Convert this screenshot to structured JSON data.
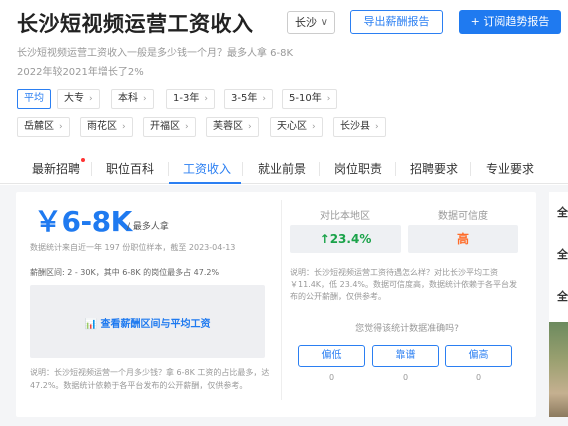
{
  "header": {
    "title": "长沙短视频运营工资收入",
    "city": "长沙",
    "export_label": "导出薪酬报告",
    "subscribe_label": "+ 订阅趋势报告",
    "subtitle1": "长沙短视频运营工资收入一般是多少钱一个月？最多人拿 6-8K",
    "subtitle2": "2022年较2021年增长了2%"
  },
  "filters": {
    "edu": [
      "平均",
      "大专",
      "本科",
      "1-3年",
      "3-5年",
      "5-10年"
    ],
    "districts": [
      "岳麓区",
      "雨花区",
      "开福区",
      "芙蓉区",
      "天心区",
      "长沙县"
    ]
  },
  "tabs": [
    "最新招聘",
    "职位百科",
    "工资收入",
    "就业前景",
    "岗位职责",
    "招聘要求",
    "专业要求"
  ],
  "salary": {
    "value": "￥6-8K",
    "unit": "/ 最多人拿",
    "stat_note": "数据统计来自近一年 197 份职位样本，截至 2023-04-13",
    "range_note": "薪酬区间: 2 - 30K，其中 6-8K 的岗位最多占 47.2%",
    "chart_button": "📊 查看薪酬区间与平均工资",
    "bottom_note": "说明：长沙短视频运营一个月多少钱？拿 6-8K 工资的占比最多，达 47.2%。数据统计依赖于各平台发布的公开薪酬，仅供参考。"
  },
  "compare": {
    "head_left": "对比本地区",
    "head_right": "数据可信度",
    "diff": "↑23.4%",
    "credibility": "高",
    "explain": "说明：长沙短视频运营工资待遇怎么样？对比长沙平均工资 ￥11.4K，低 23.4%。数据可信度高，数据统计依赖于各平台发布的公开薪酬，仅供参考。",
    "ask": "您觉得该统计数据准确吗?",
    "votes": [
      {
        "label": "偏低",
        "count": "0"
      },
      {
        "label": "靠谱",
        "count": "0"
      },
      {
        "label": "偏高",
        "count": "0"
      }
    ]
  },
  "sidebar_right": [
    "全",
    "全",
    "全"
  ],
  "colors": {
    "accent": "#1f7af0",
    "green": "#1ba34a",
    "orange": "#ff6d2a"
  }
}
